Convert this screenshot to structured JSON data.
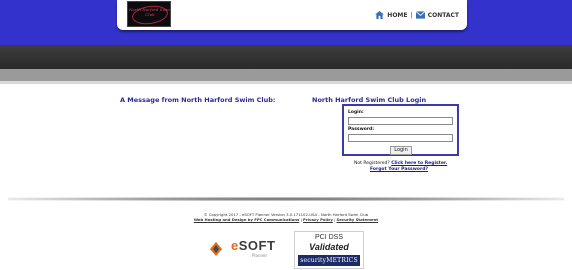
{
  "header": {
    "logo_text": "North Harford Swim Club",
    "nav": {
      "home_label": "HOME",
      "separator": "|",
      "contact_label": "CONTACT"
    }
  },
  "main": {
    "message_title": "A Message from North Harford Swim Club:",
    "login": {
      "title": "North Harford Swim Club Login",
      "login_label": "Login:",
      "login_value": "",
      "password_label": "Password:",
      "password_value": "",
      "button_label": "Login",
      "not_registered_text": "Not Registered?",
      "register_link": "Click here to Register.",
      "forgot_link": "Forgot Your Password?"
    }
  },
  "footer": {
    "copyright": "© Copyright 2017 - eSOFT Planner Version 3.0.171102-USA - North Harford Swim Club",
    "hosting_link": "Web Hosting and Design by FPC Communications",
    "separator": "|",
    "privacy_link": "Privacy Policy",
    "security_link": "Security Statement",
    "esoft_prefix": "e",
    "esoft_name": "SOFT",
    "esoft_sub": "Planner",
    "pci_line1": "PCI DSS",
    "pci_line2": "Validated",
    "pci_brand": "securityMETRICS"
  },
  "colors": {
    "header_blue": "#3333cc",
    "link_blue": "#1a1a8a",
    "title_blue": "#2a2a9a",
    "esoft_orange": "#e06a1b"
  }
}
